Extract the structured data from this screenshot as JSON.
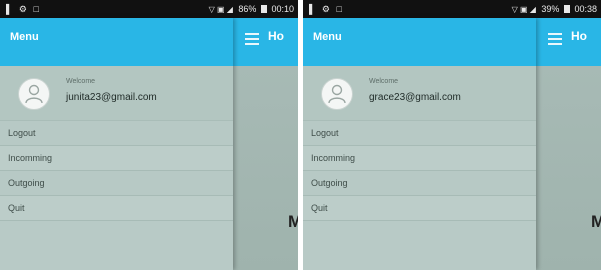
{
  "phones": [
    {
      "status": {
        "left": "▌ ⚙ □",
        "signal": "▽ ▣ ◢",
        "battery": "86%",
        "time": "00:10"
      },
      "main_title": "Ho",
      "main_letter": "M",
      "drawer": {
        "title": "Menu",
        "welcome": "Welcome",
        "email": "junita23@gmail.com",
        "items": [
          "Logout",
          "Incomming",
          "Outgoing",
          "Quit"
        ]
      }
    },
    {
      "status": {
        "left": "▌ ⚙ □",
        "signal": "▽ ▣ ◢",
        "battery": "39%",
        "time": "00:38"
      },
      "main_title": "Ho",
      "main_letter": "M",
      "drawer": {
        "title": "Menu",
        "welcome": "Welcome",
        "email": "grace23@gmail.com",
        "items": [
          "Logout",
          "Incomming",
          "Outgoing",
          "Quit"
        ]
      }
    }
  ],
  "colors": {
    "appbar": "#29b6e6",
    "drawer": "#b8cac6",
    "status_bar": "#111111"
  },
  "icons": [
    "menu-hamburger-icon",
    "avatar-person-icon",
    "signal-icon",
    "battery-icon"
  ]
}
